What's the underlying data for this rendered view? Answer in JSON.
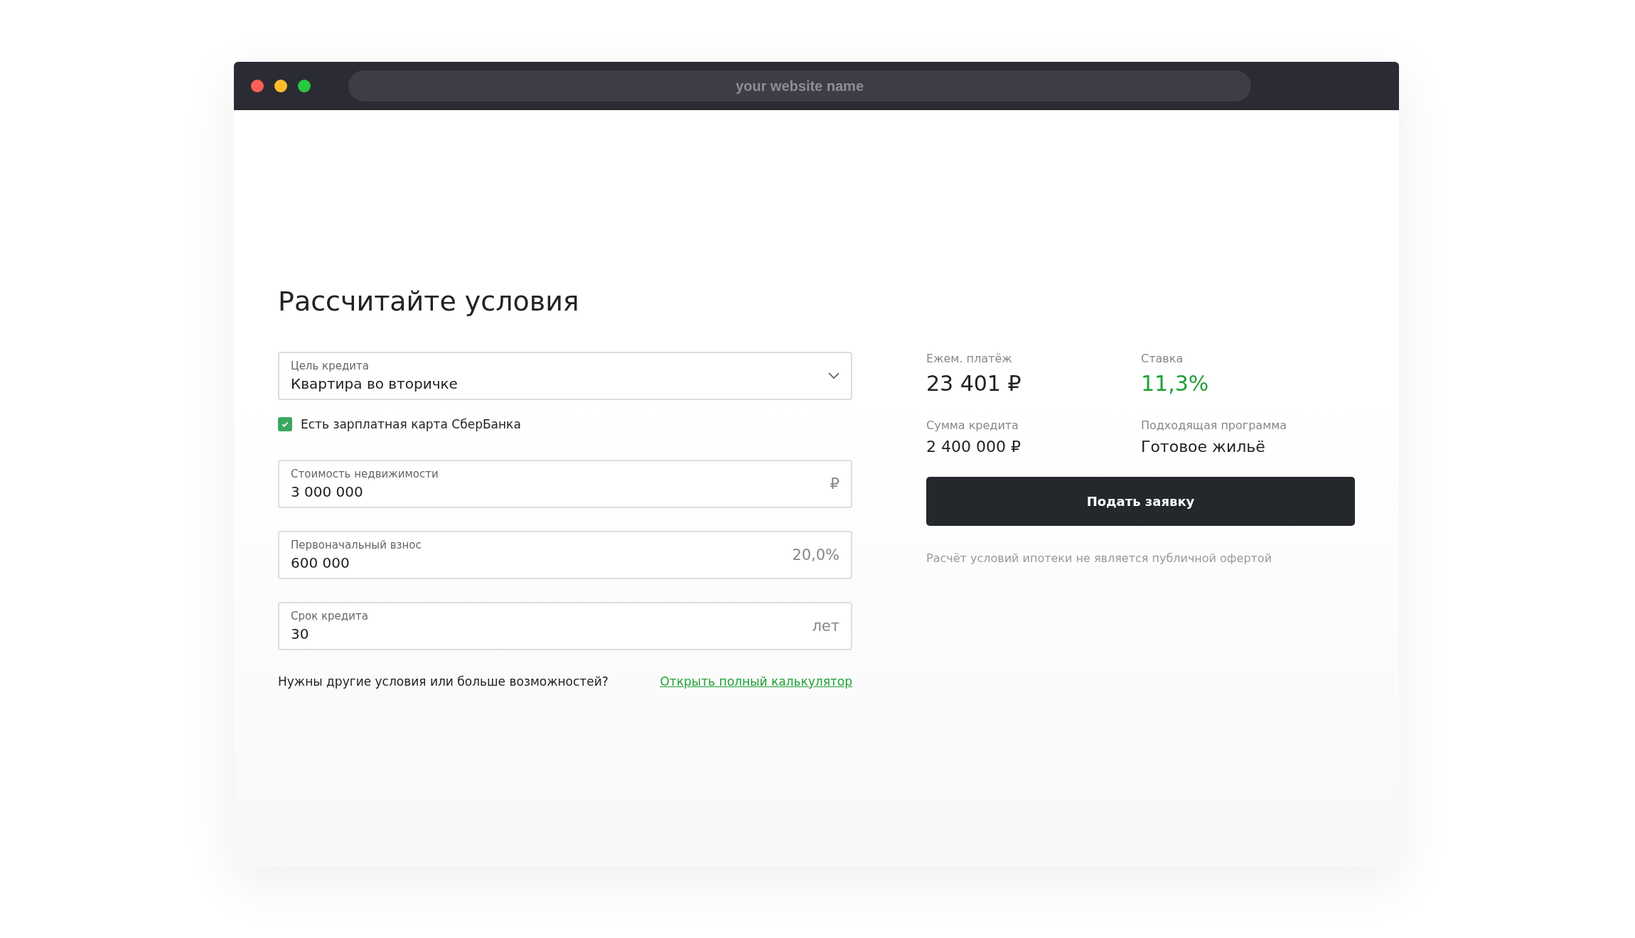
{
  "browser": {
    "address": "your website name"
  },
  "heading": "Рассчитайте условия",
  "fields": [
    {
      "kind": "select",
      "label": "Цель кредита",
      "value": "Квартира во вторичке"
    },
    {
      "kind": "checkbox",
      "label": "Есть зарплатная карта СберБанка",
      "checked": true
    },
    {
      "kind": "input",
      "label": "Стоимость недвижимости",
      "value": "3 000 000",
      "suffix": "₽"
    },
    {
      "kind": "input",
      "label": "Первоначальный взнос",
      "value": "600 000",
      "suffix": "20,0%"
    },
    {
      "kind": "input",
      "label": "Срок кредита",
      "value": "30",
      "suffix": "лет"
    }
  ],
  "more": {
    "question": "Нужны другие условия или больше возможностей?",
    "link": "Открыть полный калькулятор"
  },
  "summary": [
    {
      "label": "Ежем. платёж",
      "value": "23 401 ₽",
      "kind": "headline",
      "accent": false
    },
    {
      "label": "Ставка",
      "value": "11,3%",
      "kind": "headline",
      "accent": true
    },
    {
      "label": "Сумма кредита",
      "value": "2 400 000 ₽",
      "kind": "detail",
      "accent": false
    },
    {
      "label": "Подходящая программа",
      "value": "Готовое жильё",
      "kind": "detail",
      "accent": false
    }
  ],
  "submit": "Подать заявку",
  "disclaimer": "Расчёт условий ипотеки не является публичной офертой"
}
